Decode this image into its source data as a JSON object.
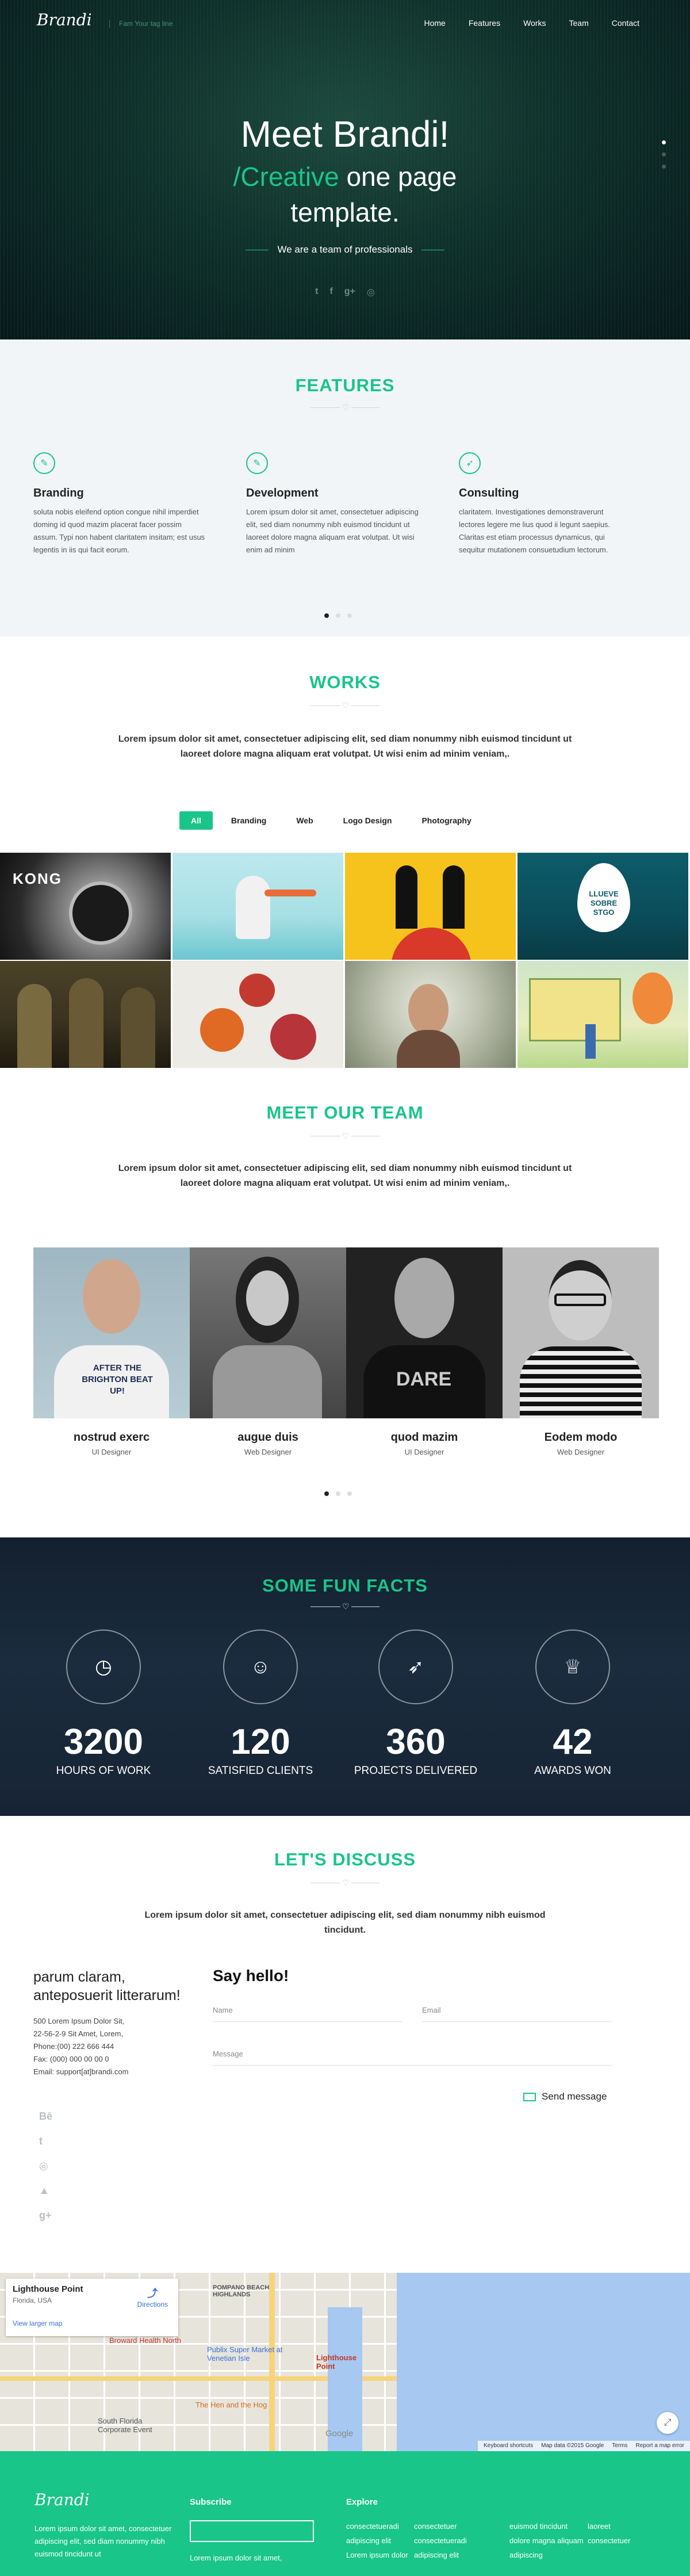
{
  "brand": {
    "logo": "Brandi",
    "tagline": "Fam Your tag line"
  },
  "nav": {
    "items": [
      "Home",
      "Features",
      "Works",
      "Team",
      "Contact"
    ]
  },
  "hero": {
    "line1_a": "Meet ",
    "line1_b": "Brandi!",
    "line2_a": "/Creative",
    "line2_b": " one page",
    "line3": "template.",
    "sub": "We are a team of professionals",
    "social": [
      "twitter-icon",
      "facebook-icon",
      "google-plus-icon",
      "dribbble-icon"
    ]
  },
  "features": {
    "title": "FEATURES",
    "items": [
      {
        "icon": "pencil-icon",
        "title": "Branding",
        "text": "soluta nobis eleifend option congue nihil imperdiet doming id quod mazim placerat facer possim assum. Typi non habent claritatem insitam; est usus legentis in iis qui facit eorum."
      },
      {
        "icon": "pencil-icon",
        "title": "Development",
        "text": "Lorem ipsum dolor sit amet, consectetuer adipiscing elit, sed diam nonummy nibh euismod tincidunt ut laoreet dolore magna aliquam erat volutpat. Ut wisi enim ad minim"
      },
      {
        "icon": "rocket-icon",
        "title": "Consulting",
        "text": "claritatem. Investigationes demonstraverunt lectores legere me lius quod ii legunt saepius. Claritas est etiam processus dynamicus, qui sequitur mutationem consuetudium lectorum."
      }
    ]
  },
  "works": {
    "title": "WORKS",
    "text": "Lorem ipsum dolor sit amet, consectetuer adipiscing elit, sed diam nonummy nibh euismod tincidunt ut laoreet dolore magna aliquam erat volutpat. Ut wisi enim ad minim veniam,.",
    "filters": [
      "All",
      "Branding",
      "Web",
      "Logo Design",
      "Photography"
    ],
    "tile_texts": {
      "kong": "KONG",
      "llueve_1": "LLUEVE",
      "llueve_2": "SOBRE",
      "llueve_3": "STGO"
    }
  },
  "team": {
    "title": "MEET OUR TEAM",
    "text": "Lorem ipsum dolor sit amet, consectetuer adipiscing elit, sed diam nonummy nibh euismod tincidunt ut laoreet dolore magna aliquam erat volutpat. Ut wisi enim ad minim veniam,.",
    "members": [
      {
        "name": "nostrud exerc",
        "role": "UI Designer",
        "shirt": "AFTER THE BRIGHTON BEAT UP!"
      },
      {
        "name": "augue duis",
        "role": "Web Designer"
      },
      {
        "name": "quod mazim",
        "role": "UI Designer",
        "shirt": "DARE"
      },
      {
        "name": "Eodem modo",
        "role": "Web Designer"
      }
    ]
  },
  "facts": {
    "title": "SOME FUN FACTS",
    "items": [
      {
        "icon": "clock-icon",
        "value": "3200",
        "label": "HOURS OF WORK"
      },
      {
        "icon": "user-icon",
        "value": "120",
        "label": "SATISFIED CLIENTS"
      },
      {
        "icon": "rocket-icon",
        "value": "360",
        "label": "PROJECTS DELIVERED"
      },
      {
        "icon": "trophy-icon",
        "value": "42",
        "label": "AWARDS WON"
      }
    ]
  },
  "discuss": {
    "title": "LET'S DISCUSS",
    "text": "Lorem ipsum dolor sit amet, consectetuer adipiscing elit, sed diam nonummy nibh euismod tincidunt.",
    "aside_title": "parum claram, anteposuerit litterarum!",
    "address": [
      "500 Lorem Ipsum Dolor Sit,",
      "22-56-2-9 Sit Amet, Lorem,",
      "Phone:(00) 222 666 444",
      "Fax: (000) 000 00 00 0",
      "Email: support[at]brandi.com"
    ],
    "social": [
      "behance-icon",
      "twitter-icon",
      "dribbble-icon",
      "warning-icon",
      "google-plus-icon"
    ],
    "say_hello": "Say hello!",
    "name_placeholder": "Name",
    "email_placeholder": "Email",
    "message_placeholder": "Message",
    "send": "Send message"
  },
  "map": {
    "place": "Lighthouse Point",
    "place_sub": "Florida, USA",
    "larger": "View larger map",
    "directions": "Directions",
    "labels": [
      "POMPANO BEACH HIGHLANDS",
      "Broward Health North",
      "Publix Super Market at Venetian Isle",
      "Lighthouse Point",
      "The Hen and the Hog",
      "South Florida Corporate Event"
    ],
    "google": "Google",
    "footer": [
      "Keyboard shortcuts",
      "Map data ©2015 Google",
      "Terms",
      "Report a map error"
    ]
  },
  "footer": {
    "logo": "Brandi",
    "text": "Lorem ipsum dolor sit amet, consectetuer adipiscing elit, sed diam nonummy nibh euismod tincidunt ut",
    "subscribe": "Subscribe",
    "subscribe_text": "Lorem ipsum dolor sit amet,",
    "explore": "Explore",
    "explore_col1": [
      "consectetueradi",
      "adipiscing elit",
      "Lorem ipsum dolor"
    ],
    "explore_col2": [
      "consectetuer",
      "consectetueradi",
      "adipiscing elit"
    ],
    "explore_col3": [
      "euismod tincidunt",
      "dolore magna aliquam",
      "adipiscing"
    ],
    "explore_col4": [
      "laoreet",
      "consectetuer"
    ]
  }
}
